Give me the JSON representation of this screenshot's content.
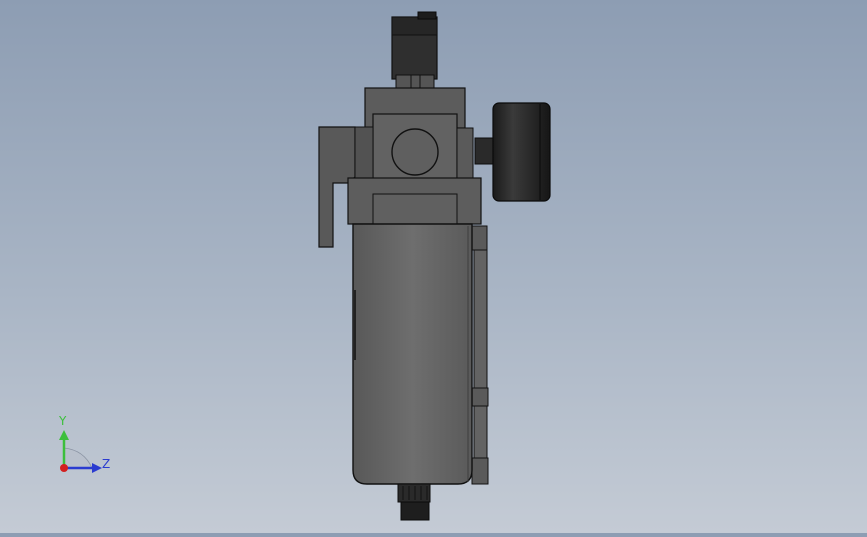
{
  "viewport": {
    "background_top": "#8d9db3",
    "background_bottom": "#c4cbd5",
    "model_name": "air-filter-regulator-with-gauge"
  },
  "triad": {
    "y_label": "Y",
    "z_label": "Z",
    "y_color": "#3cbf3c",
    "z_color": "#2a3bd0",
    "x_color": "#d22020"
  }
}
